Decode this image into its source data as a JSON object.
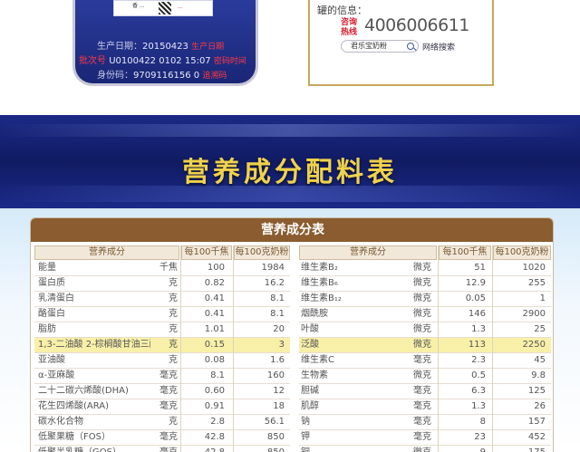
{
  "can": {
    "label_text": "香 ...",
    "label_red": "...",
    "production_date_label": "生产日期：",
    "production_date": "20150423",
    "production_date_note": "生产日期",
    "batch_label": "批次号",
    "batch": "U0100422  0102 15:07",
    "batch_note": "密码时间",
    "id_label": "身份码：",
    "id_code": "9709116156 0",
    "id_note": "追溯码"
  },
  "info": {
    "title": "罐的信息：",
    "hotline_label": "咨询热线",
    "hotline_number": "4006006611",
    "search_placeholder": "君乐宝奶粉",
    "search_button": "网络搜索"
  },
  "banner": {
    "title": "营养成分配料表"
  },
  "table": {
    "title": "营养成分表",
    "headers": [
      "营养成分",
      "每100千焦",
      "每100克奶粉"
    ],
    "left_rows": [
      {
        "name": "能量",
        "unit": "千焦",
        "v1": "100",
        "v2": "1984"
      },
      {
        "name": "蛋白质",
        "unit": "克",
        "v1": "0.82",
        "v2": "16.2"
      },
      {
        "name": "乳清蛋白",
        "unit": "克",
        "v1": "0.41",
        "v2": "8.1"
      },
      {
        "name": "酪蛋白",
        "unit": "克",
        "v1": "0.41",
        "v2": "8.1"
      },
      {
        "name": "脂肪",
        "unit": "克",
        "v1": "1.01",
        "v2": "20"
      },
      {
        "name": "1,3-二油酸 2-棕榈酸甘油三酯",
        "unit": "克",
        "v1": "0.15",
        "v2": "3",
        "highlight": true
      },
      {
        "name": "亚油酸",
        "unit": "克",
        "v1": "0.08",
        "v2": "1.6"
      },
      {
        "name": "α-亚麻酸",
        "unit": "毫克",
        "v1": "8.1",
        "v2": "160"
      },
      {
        "name": "二十二碳六烯酸(DHA)",
        "unit": "毫克",
        "v1": "0.60",
        "v2": "12"
      },
      {
        "name": "花生四烯酸(ARA)",
        "unit": "毫克",
        "v1": "0.91",
        "v2": "18"
      },
      {
        "name": "碳水化合物",
        "unit": "克",
        "v1": "2.8",
        "v2": "56.1"
      },
      {
        "name": "低聚果糖（FOS）",
        "unit": "毫克",
        "v1": "42.8",
        "v2": "850"
      },
      {
        "name": "低聚半乳糖（GOS）",
        "unit": "毫克",
        "v1": "42.8",
        "v2": "850"
      }
    ],
    "right_rows": [
      {
        "name": "维生素B₂",
        "unit": "微克",
        "v1": "51",
        "v2": "1020"
      },
      {
        "name": "维生素B₆",
        "unit": "微克",
        "v1": "12.9",
        "v2": "255"
      },
      {
        "name": "维生素B₁₂",
        "unit": "微克",
        "v1": "0.05",
        "v2": "1"
      },
      {
        "name": "烟酰胺",
        "unit": "微克",
        "v1": "146",
        "v2": "2900"
      },
      {
        "name": "叶酸",
        "unit": "微克",
        "v1": "1.3",
        "v2": "25"
      },
      {
        "name": "泛酸",
        "unit": "微克",
        "v1": "113",
        "v2": "2250",
        "highlight": true
      },
      {
        "name": "维生素C",
        "unit": "毫克",
        "v1": "2.3",
        "v2": "45"
      },
      {
        "name": "生物素",
        "unit": "微克",
        "v1": "0.5",
        "v2": "9.8"
      },
      {
        "name": "胆碱",
        "unit": "毫克",
        "v1": "6.3",
        "v2": "125"
      },
      {
        "name": "肌醇",
        "unit": "毫克",
        "v1": "1.3",
        "v2": "26"
      },
      {
        "name": "钠",
        "unit": "毫克",
        "v1": "8",
        "v2": "157"
      },
      {
        "name": "钾",
        "unit": "毫克",
        "v1": "23",
        "v2": "452"
      },
      {
        "name": "铜",
        "unit": "微克",
        "v1": "9",
        "v2": "175"
      }
    ]
  }
}
